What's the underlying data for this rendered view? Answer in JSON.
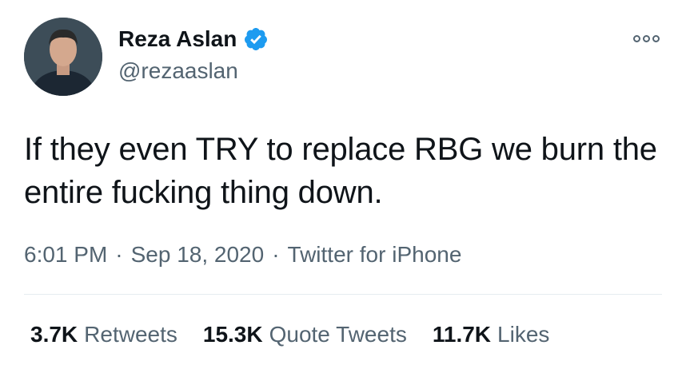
{
  "author": {
    "display_name": "Reza Aslan",
    "handle": "@rezaaslan",
    "verified": true
  },
  "tweet": {
    "text": "If they even TRY to replace RBG we burn the entire fucking thing down.",
    "time": "6:01 PM",
    "date": "Sep 18, 2020",
    "source": "Twitter for iPhone",
    "separator": "·"
  },
  "stats": {
    "retweets_count": "3.7K",
    "retweets_label": "Retweets",
    "quotes_count": "15.3K",
    "quotes_label": "Quote Tweets",
    "likes_count": "11.7K",
    "likes_label": "Likes"
  },
  "icons": {
    "verified": "verified-badge-icon",
    "more": "more-options-icon"
  },
  "colors": {
    "text": "#0f1419",
    "secondary": "#536471",
    "verified_blue": "#1d9bf0",
    "divider": "#e6ecf0"
  }
}
